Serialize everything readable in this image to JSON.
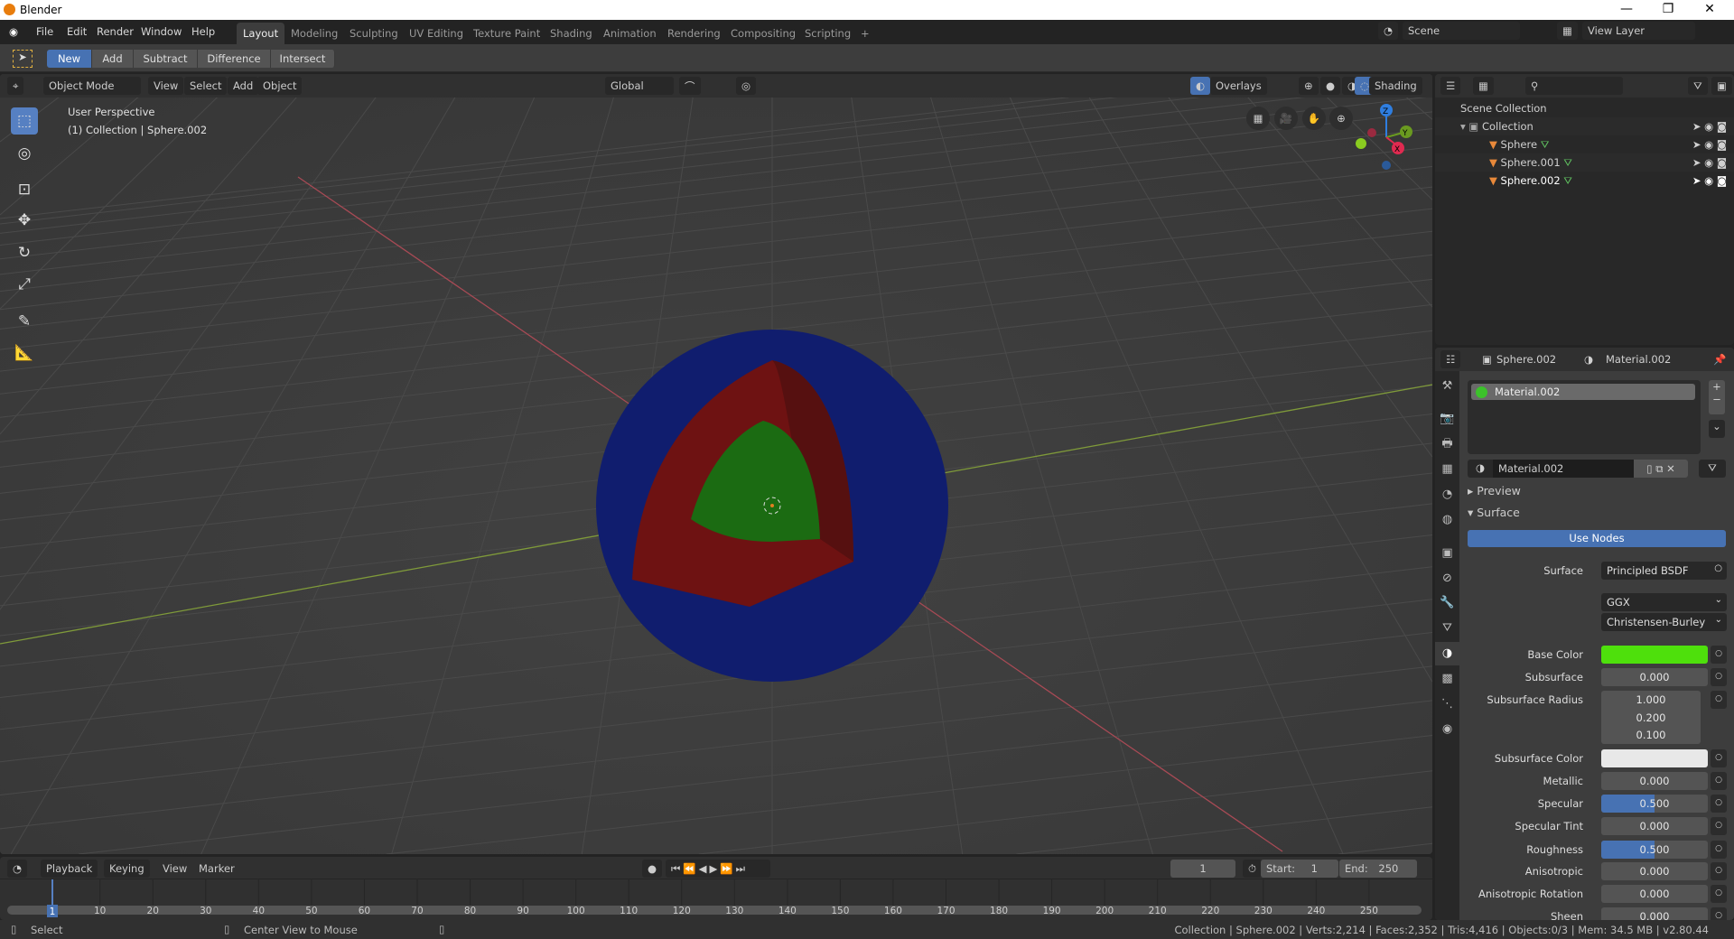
{
  "window": {
    "title": "Blender",
    "minimize": "—",
    "maximize": "❐",
    "close": "✕"
  },
  "menu": [
    "File",
    "Edit",
    "Render",
    "Window",
    "Help"
  ],
  "workspaces": [
    "Layout",
    "Modeling",
    "Sculpting",
    "UV Editing",
    "Texture Paint",
    "Shading",
    "Animation",
    "Rendering",
    "Compositing",
    "Scripting",
    "+"
  ],
  "scene": {
    "name": "Scene",
    "view_layer": "View Layer"
  },
  "tool_header": {
    "modes": [
      "New",
      "Add",
      "Subtract",
      "Difference",
      "Intersect"
    ],
    "active": "New"
  },
  "viewport": {
    "header": {
      "mode": "Object Mode",
      "menus": [
        "View",
        "Select",
        "Add",
        "Object"
      ],
      "orientation": "Global",
      "overlays": "Overlays",
      "shading": "Shading"
    },
    "info_line1": "User Perspective",
    "info_line2": "(1) Collection | Sphere.002",
    "gizmo": {
      "z": "Z",
      "y": "Y",
      "x": "X"
    },
    "sphere_colors": {
      "outer": "#101d6e",
      "middle": "#6e1212",
      "inner": "#1b6b12"
    }
  },
  "outliner": {
    "root": "Scene Collection",
    "collection": "Collection",
    "objects": [
      "Sphere",
      "Sphere.001",
      "Sphere.002"
    ]
  },
  "properties": {
    "object": "Sphere.002",
    "material": "Material.002",
    "slot": "Material.002",
    "slot_color": "#3cc22b",
    "material_field": "Material.002",
    "preview": "Preview",
    "surface_panel": "Surface",
    "use_nodes": "Use Nodes",
    "surface_label": "Surface",
    "surface_value": "Principled BSDF",
    "distribution": "GGX",
    "subsurface_method": "Christensen-Burley",
    "fields": [
      {
        "label": "Base Color",
        "color": "#4ee00c"
      },
      {
        "label": "Subsurface",
        "value": "0.000"
      },
      {
        "label": "Subsurface Radius",
        "value": "1.000"
      },
      {
        "label": "",
        "value": "0.200"
      },
      {
        "label": "",
        "value": "0.100"
      },
      {
        "label": "Subsurface Color",
        "color": "#e8e8e8"
      },
      {
        "label": "Metallic",
        "value": "0.000"
      },
      {
        "label": "Specular",
        "value": "0.500",
        "fraction": 0.5
      },
      {
        "label": "Specular Tint",
        "value": "0.000"
      },
      {
        "label": "Roughness",
        "value": "0.500",
        "fraction": 0.5
      },
      {
        "label": "Anisotropic",
        "value": "0.000"
      },
      {
        "label": "Anisotropic Rotation",
        "value": "0.000"
      },
      {
        "label": "Sheen",
        "value": "0.000"
      }
    ]
  },
  "timeline": {
    "menus": [
      "Playback",
      "Keying",
      "View",
      "Marker"
    ],
    "current_frame": "1",
    "start_label": "Start:",
    "start": "1",
    "end_label": "End:",
    "end": "250",
    "ticks": [
      "10",
      "20",
      "30",
      "40",
      "50",
      "60",
      "70",
      "80",
      "90",
      "100",
      "110",
      "120",
      "130",
      "140",
      "150",
      "160",
      "170",
      "180",
      "190",
      "200",
      "210",
      "220",
      "230",
      "240",
      "250"
    ],
    "playhead": "1"
  },
  "status": {
    "left": "Select",
    "middle": "Center View to Mouse",
    "right": "Collection | Sphere.002 | Verts:2,214 | Faces:2,352 | Tris:4,416 | Objects:0/3 | Mem: 34.5 MB | v2.80.44"
  },
  "accent": "#4772b3"
}
